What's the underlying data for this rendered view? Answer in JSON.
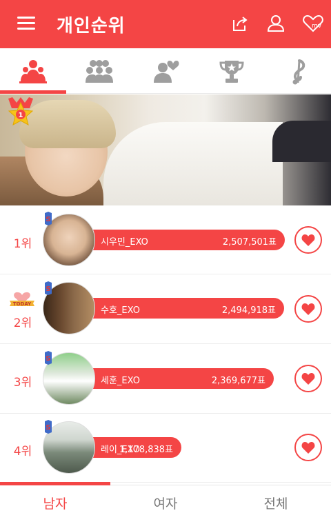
{
  "header": {
    "title": "개인순위",
    "menu_icon": "hamburger-menu-icon",
    "icons": [
      "share-icon",
      "profile-icon",
      "mv-heart-icon"
    ],
    "mv_label": "mv"
  },
  "category_tabs": [
    {
      "icon": "individual-ranking-icon",
      "active": true
    },
    {
      "icon": "group-ranking-icon",
      "active": false
    },
    {
      "icon": "couple-icon",
      "active": false
    },
    {
      "icon": "trophy-icon",
      "active": false
    },
    {
      "icon": "music-note-icon",
      "active": false
    }
  ],
  "banner": {
    "badge_number": "1"
  },
  "rankings": [
    {
      "rank": "1위",
      "name": "시우민_EXO",
      "votes": "2,507,501표",
      "today_badge": false,
      "vote_share": 1.0
    },
    {
      "rank": "2위",
      "name": "수호_EXO",
      "votes": "2,494,918표",
      "today_badge": true,
      "today_label": "TODAY",
      "vote_share": 0.995
    },
    {
      "rank": "3위",
      "name": "세훈_EXO",
      "votes": "2,369,677표",
      "today_badge": false,
      "vote_share": 0.945
    },
    {
      "rank": "4위",
      "name": "레이_EXO",
      "votes": "1,178,838표",
      "today_badge": false,
      "vote_share": 0.47
    }
  ],
  "bottom_tabs": [
    {
      "label": "남자",
      "active": true
    },
    {
      "label": "여자",
      "active": false
    },
    {
      "label": "전체",
      "active": false
    }
  ],
  "colors": {
    "accent": "#f44545",
    "inactive_icon": "#9e9e9e",
    "inactive_text": "#777777"
  }
}
